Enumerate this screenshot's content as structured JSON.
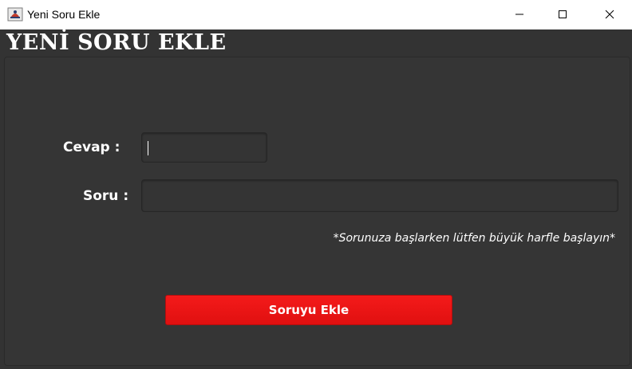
{
  "window": {
    "title": "Yeni Soru Ekle",
    "app_icon": "java-coffee-icon",
    "controls": {
      "minimize_icon": "minimize-icon",
      "maximize_icon": "maximize-icon",
      "close_icon": "close-icon"
    }
  },
  "form": {
    "heading": "YENİ SORU EKLE",
    "answer": {
      "label": "Cevap :",
      "value": "",
      "placeholder": ""
    },
    "question": {
      "label": "Soru :",
      "value": "",
      "placeholder": ""
    },
    "hint": "*Sorunuza başlarken lütfen büyük harfle başlayın*",
    "submit_label": "Soruyu Ekle"
  },
  "colors": {
    "background": "#333333",
    "accent_button": "#ec1414",
    "text": "#ffffff"
  }
}
